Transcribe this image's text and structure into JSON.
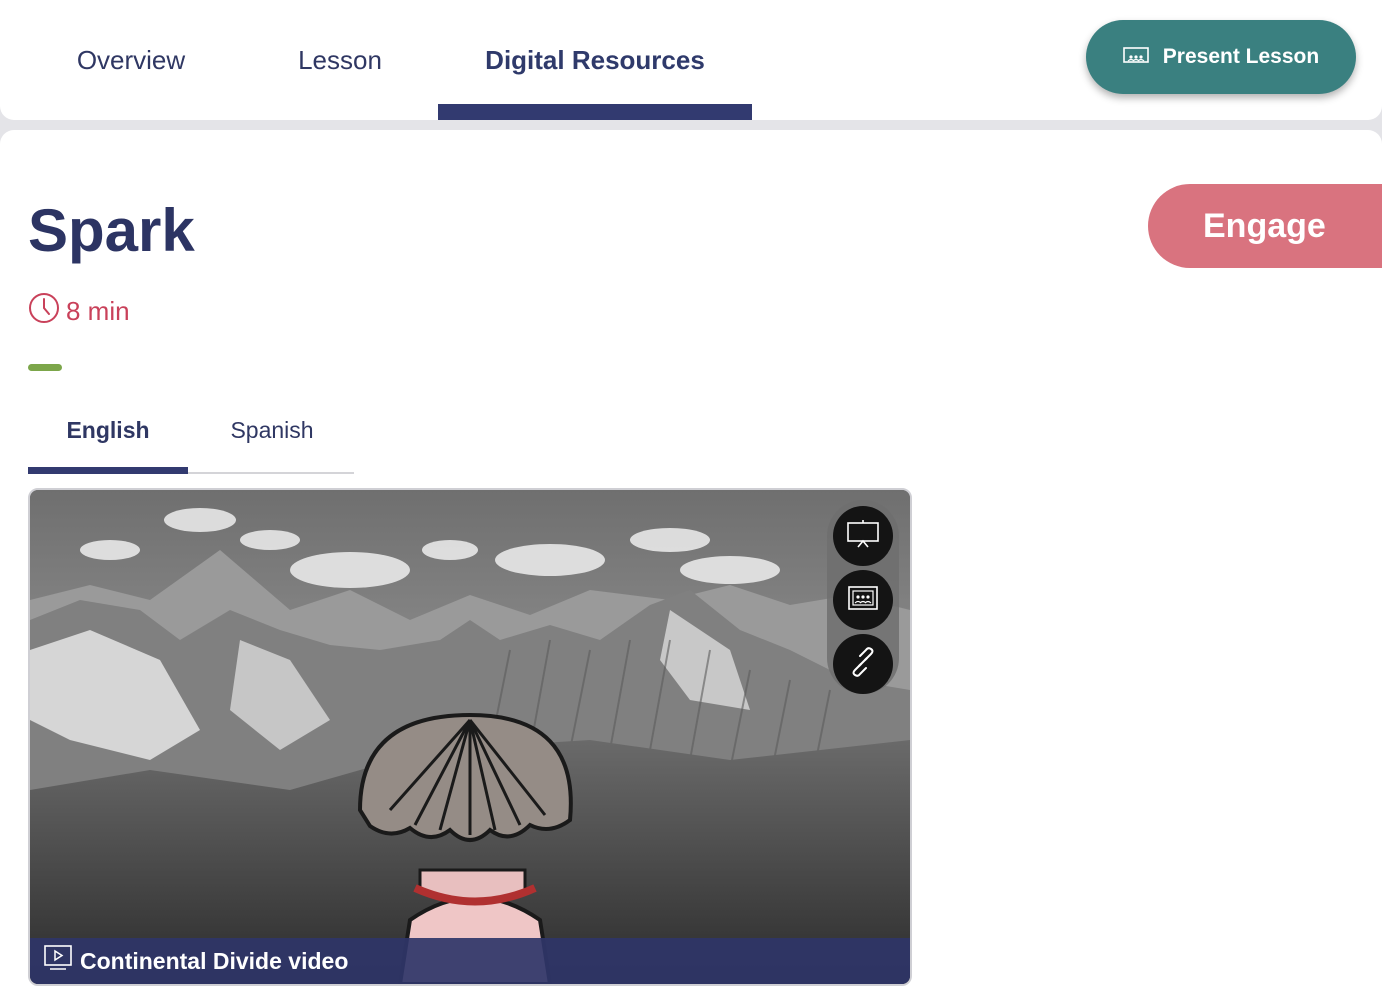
{
  "nav": {
    "tabs": [
      {
        "label": "Overview"
      },
      {
        "label": "Lesson"
      },
      {
        "label": "Digital Resources"
      }
    ],
    "active_tab": "Digital Resources",
    "present_button_label": "Present Lesson"
  },
  "section": {
    "title": "Spark",
    "phase_badge": "Engage",
    "duration": "8 min"
  },
  "language_tabs": [
    {
      "label": "English"
    },
    {
      "label": "Spanish"
    }
  ],
  "active_language": "English",
  "video": {
    "caption": "Continental Divide video",
    "tools": [
      "present-icon",
      "classroom-display-icon",
      "link-icon"
    ]
  },
  "colors": {
    "navy": "#2f3763",
    "teal": "#3a8080",
    "engage_pink": "#d9737f",
    "duration_red": "#c9415a",
    "accent_green": "#7ca64a"
  }
}
